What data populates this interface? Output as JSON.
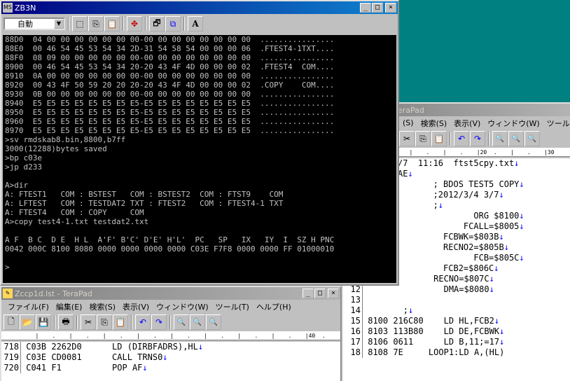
{
  "colors": {
    "desktop": "#008080",
    "title_active": "#000080",
    "eol": "#0000ff"
  },
  "tp1": {
    "title": "TeraPad",
    "title_prefix": "eraPad",
    "menus": [
      "(S)",
      "検索(S)",
      "表示(V)",
      "ウィンドウ(W)",
      "ツール(T)"
    ],
    "ruler": "   |    .    |    .    |20  .    |    .    |30",
    "lines_top": [
      {
        "text": "/7  11:16  ftst5cpy.txt",
        "eol": "↓"
      },
      {
        "text": "AE",
        "eol": "↓"
      },
      {
        "text": "       ; BDOS TEST5 COPY",
        "eol": "↓"
      },
      {
        "text": "       ;2012/3/4 3/7",
        "eol": "↓"
      },
      {
        "text": "       ;",
        "eol": "↓"
      },
      {
        "text": "               ORG $8100",
        "eol": "↓"
      },
      {
        "text": "             FCALL=$8005",
        "eol": "↓"
      },
      {
        "text": "         FCBWK=$803B",
        "eol": "↓"
      },
      {
        "text": "         RECNO2=$805B",
        "eol": "↓"
      },
      {
        "text": "               FCB=$805C",
        "eol": "↓"
      },
      {
        "text": "         FCB2=$806C",
        "eol": "↓"
      }
    ],
    "lines_num": [
      {
        "n": "11",
        "text": "             RECNO=$807C",
        "eol": "↓"
      },
      {
        "n": "12",
        "text": "               DMA=$8080",
        "eol": "↓"
      },
      {
        "n": "13",
        "text": "",
        "eol": ""
      },
      {
        "n": "14",
        "text": "       ;",
        "eol": "↓"
      },
      {
        "n": "15",
        "text": "8100 216C80    LD HL,FCB2",
        "eol": "↓"
      },
      {
        "n": "16",
        "text": "8103 113B80    LD DE,FCBWK",
        "eol": "↓"
      },
      {
        "n": "17",
        "text": "8106 0611      LD B,11;=17",
        "eol": "↓"
      },
      {
        "n": "18",
        "text": "8108 7E     LOOP1:LD A,(HL)",
        "eol": ""
      }
    ]
  },
  "zb3n": {
    "title": "ZB3N",
    "combo_value": "自動",
    "console": [
      "88D0  04 00 00 00 00 00 00 00-00 00 00 00 00 00 00 00  ................",
      "88E0  00 46 54 45 53 54 34 2D-31 54 58 54 00 00 00 06  .FTEST4-1TXT....",
      "88F0  08 09 00 00 00 00 00 00-00 00 00 00 00 00 00 00  ................",
      "8900  00 46 54 45 53 54 34 20-20 43 4F 4D 00 00 00 02  .FTEST4  COM....",
      "8910  0A 00 00 00 00 00 00 00-00 00 00 00 00 00 00 00  ................",
      "8920  00 43 4F 50 59 20 20 20-20 43 4F 4D 00 00 00 02  .COPY    COM....",
      "8930  0B 00 00 00 00 00 00 00-00 00 00 00 00 00 00 00  ................",
      "8940  E5 E5 E5 E5 E5 E5 E5 E5-E5 E5 E5 E5 E5 E5 E5 E5  ................",
      "8950  E5 E5 E5 E5 E5 E5 E5 E5-E5 E5 E5 E5 E5 E5 E5 E5  ................",
      "8960  E5 E5 E5 E5 E5 E5 E5 E5-E5 E5 E5 E5 E5 E5 E5 E5  ................",
      "8970  E5 E5 E5 E5 E5 E5 E5 E5-E5 E5 E5 E5 E5 E5 E5 E5  ................",
      ">sv rmdskab8.bin,8800,b7ff",
      "3000(12288)bytes saved",
      ">bp c03e",
      ">jp d233",
      "",
      "A>dir",
      "A: FTEST1   COM : BSTEST   COM : BSTEST2  COM : FTST9    COM",
      "A: LFTEST   COM : TESTDAT2 TXT : FTEST2   COM : FTEST4-1 TXT",
      "A: FTEST4   COM : COPY     COM",
      "A>copy test4-1.txt testdat2.txt",
      "",
      "A F  B C  D E  H L  A'F' B'C' D'E' H'L'  PC   SP   IX   IY  I  SZ H PNC",
      "0042 000C 8100 8080 0000 0000 0000 0000 C03E F7F8 0000 0000 FF 01000010",
      "",
      ">"
    ]
  },
  "tp2": {
    "title": "Zccp1d.lst - TeraPad",
    "menus": [
      "ファイル(F)",
      "編集(E)",
      "検索(S)",
      "表示(V)",
      "ウィンドウ(W)",
      "ツール(T)",
      "ヘルプ(H)"
    ],
    "ruler": "   |    .    |    .    |    .    |    .    |    .    |    .    |    .    |    .    |40  .    |    .    |5",
    "lines": [
      {
        "n": "718",
        "text": "C03B 2262D0      LD (DIRBFADRS),HL",
        "eol": "↓"
      },
      {
        "n": "719",
        "text": "C03E CD0081      CALL TRNS0",
        "eol": "↓"
      },
      {
        "n": "720",
        "text": "C041 F1          POP AF",
        "eol": "↓"
      }
    ]
  }
}
